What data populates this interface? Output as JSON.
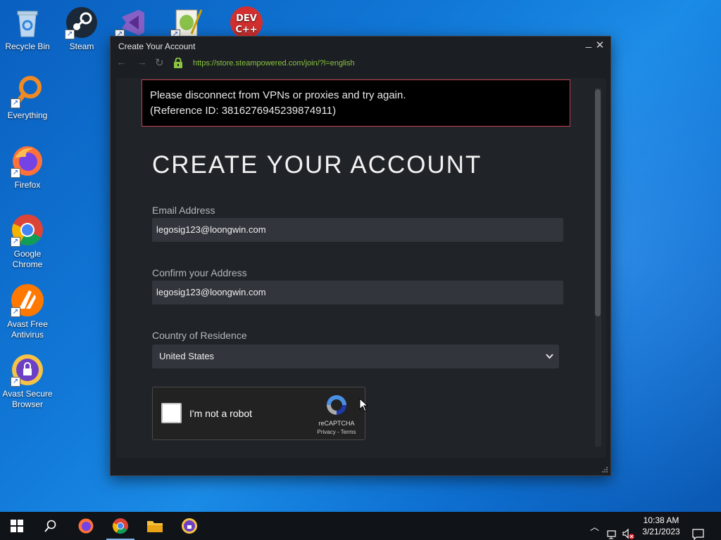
{
  "desktop": {
    "icons": [
      {
        "label": "Recycle Bin"
      },
      {
        "label": "Steam"
      },
      {
        "label": "Everything"
      },
      {
        "label": "Firefox"
      },
      {
        "label": "Google Chrome"
      },
      {
        "label": "Avast Free Antivirus"
      },
      {
        "label": "Avast Secure Browser"
      }
    ]
  },
  "window": {
    "title": "Create Your Account",
    "minimize": "_",
    "close": "✕",
    "url": "https://store.steampowered.com/join/?l=english"
  },
  "error": {
    "line1": "Please disconnect from VPNs or proxies and try again.",
    "line2": "(Reference ID: 3816276945239874911)"
  },
  "form": {
    "heading": "CREATE YOUR ACCOUNT",
    "email_label": "Email Address",
    "email_value": "legosig123@loongwin.com",
    "confirm_label": "Confirm your Address",
    "confirm_value": "legosig123@loongwin.com",
    "country_label": "Country of Residence",
    "country_value": "United States"
  },
  "captcha": {
    "text": "I'm not a robot",
    "brand": "reCAPTCHA",
    "links": "Privacy - Terms"
  },
  "taskbar": {
    "time": "10:38 AM",
    "date": "3/21/2023"
  },
  "colors": {
    "url_green": "#8bc53f",
    "error_border": "#c1414f",
    "window_bg": "#1b1e23",
    "field_bg": "#32353c"
  }
}
